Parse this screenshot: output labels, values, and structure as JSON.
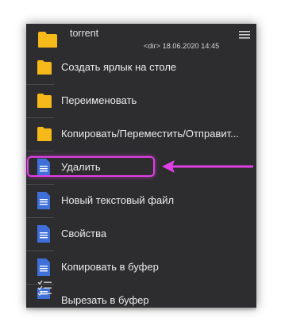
{
  "header": {
    "folder_name": "torrent",
    "meta": "<dir>  18.06.2020  14:45",
    "folder_color": "#f6b91a",
    "menu_icon": "hamburger-icon"
  },
  "menu": {
    "items": [
      {
        "label": "Создать ярлык на столе",
        "icon": "folder-icon"
      },
      {
        "label": "Переименовать",
        "icon": "folder-icon"
      },
      {
        "label": "Копировать/Переместить/Отправит...",
        "icon": "folder-icon"
      },
      {
        "label": "Удалить",
        "icon": "document-icon"
      },
      {
        "label": "Новый текстовый файл",
        "icon": "document-icon",
        "highlighted": true
      },
      {
        "label": "Свойства",
        "icon": "document-icon"
      },
      {
        "label": "Копировать в буфер",
        "icon": "document-icon"
      },
      {
        "label": "Вырезать в буфер",
        "icon": "checklist-icon"
      }
    ]
  },
  "colors": {
    "background": "#2d2d2f",
    "text": "#ececec",
    "folder": "#f6b91a",
    "document": "#3f6fd8",
    "highlight": "#e23ee6"
  }
}
